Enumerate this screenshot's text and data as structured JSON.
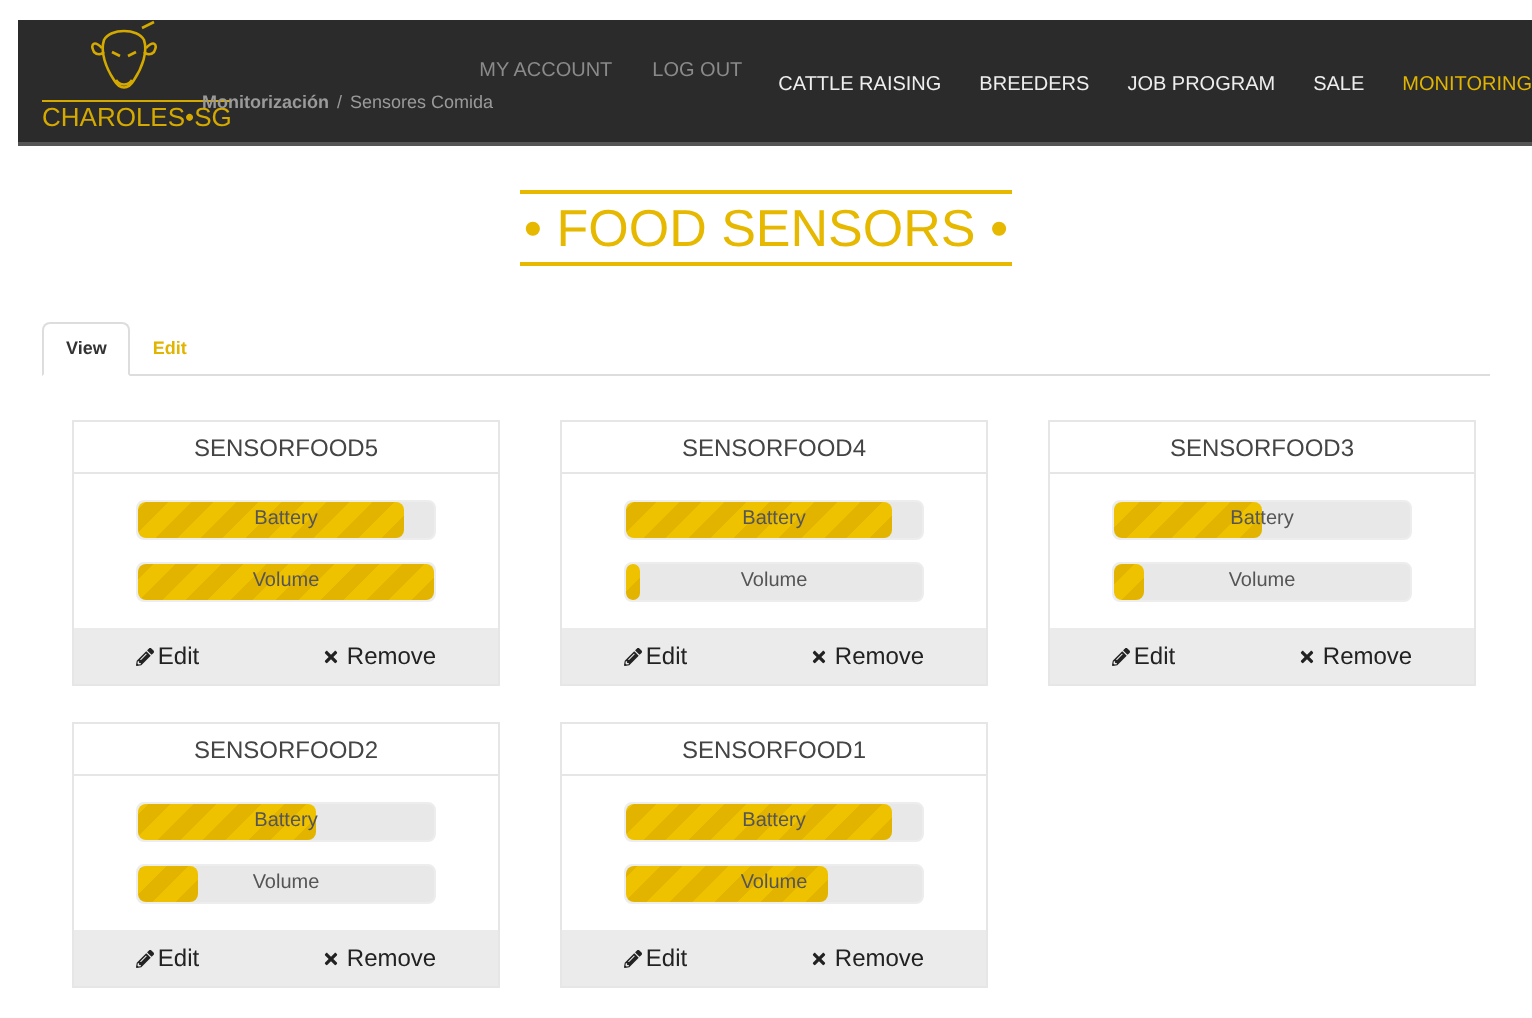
{
  "header": {
    "logo_text": "CHAROLES•SG",
    "breadcrumb": [
      "Monitorización",
      "Sensores Comida"
    ],
    "breadcrumb_separator": "/",
    "account_links": [
      "MY ACCOUNT",
      "LOG OUT"
    ],
    "nav": [
      {
        "label": "CATTLE RAISING",
        "selected": false
      },
      {
        "label": "BREEDERS",
        "selected": false
      },
      {
        "label": "JOB PROGRAM",
        "selected": false
      },
      {
        "label": "SALE",
        "selected": false
      },
      {
        "label": "MONITORING",
        "selected": true
      }
    ]
  },
  "title_bullet": "•",
  "title": "FOOD SENSORS",
  "tabs": [
    {
      "label": "View",
      "selected": true
    },
    {
      "label": "Edit",
      "selected": false
    }
  ],
  "sensors": [
    {
      "name": "SENSORFOOD5",
      "bars": [
        {
          "label": "Battery",
          "level": 0.9
        },
        {
          "label": "Volume",
          "level": 1.0
        }
      ],
      "edit": "Edit",
      "remove": "Remove"
    },
    {
      "name": "SENSORFOOD4",
      "bars": [
        {
          "label": "Battery",
          "level": 0.9
        },
        {
          "label": "Volume",
          "level": 0.05
        }
      ],
      "edit": "Edit",
      "remove": "Remove"
    },
    {
      "name": "SENSORFOOD3",
      "bars": [
        {
          "label": "Battery",
          "level": 0.5
        },
        {
          "label": "Volume",
          "level": 0.1
        }
      ],
      "edit": "Edit",
      "remove": "Remove"
    },
    {
      "name": "SENSORFOOD2",
      "bars": [
        {
          "label": "Battery",
          "level": 0.6
        },
        {
          "label": "Volume",
          "level": 0.2
        }
      ],
      "edit": "Edit",
      "remove": "Remove"
    },
    {
      "name": "SENSORFOOD1",
      "bars": [
        {
          "label": "Battery",
          "level": 0.9
        },
        {
          "label": "Volume",
          "level": 0.68
        }
      ],
      "edit": "Edit",
      "remove": "Remove"
    }
  ]
}
